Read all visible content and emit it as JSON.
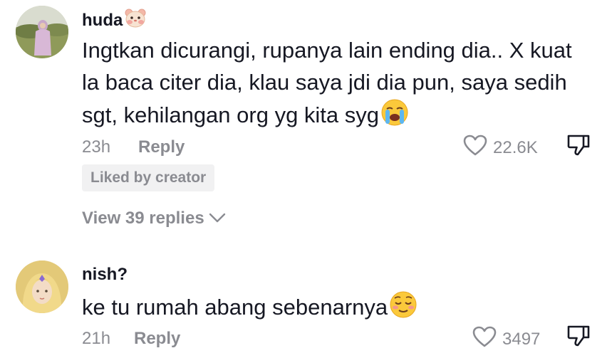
{
  "comments": [
    {
      "username": "huda",
      "username_emoji": "hamster-face-icon",
      "text": "Ingtkan dicurangi, rupanya lain ending dia.. X kuat la baca citer dia, klau saya jdi dia pun, saya sedih sgt, kehilangan org yg kita syg",
      "trailing_emoji": "loudly-crying-face-icon",
      "time": "23h",
      "reply_label": "Reply",
      "likes": "22.6K",
      "badge": "Liked by creator",
      "view_replies": "View 39 replies"
    },
    {
      "username": "nish?",
      "text": "ke tu rumah abang sebenarnya",
      "trailing_emoji": "relieved-face-icon",
      "time": "21h",
      "reply_label": "Reply",
      "likes": "3497"
    }
  ]
}
